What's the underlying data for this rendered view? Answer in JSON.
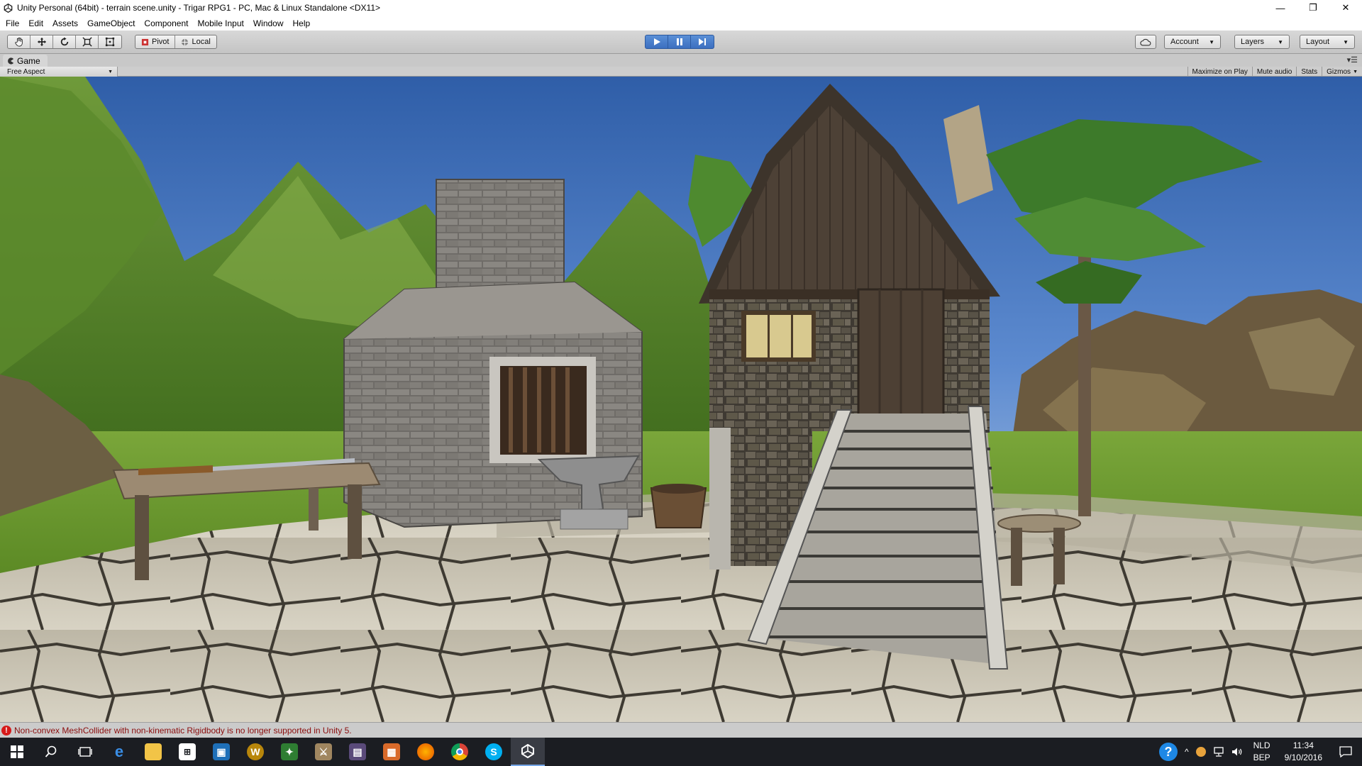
{
  "window": {
    "title": "Unity Personal (64bit) - terrain scene.unity - Trigar RPG1 - PC, Mac & Linux Standalone <DX11>",
    "controls": [
      "—",
      "❐",
      "✕"
    ]
  },
  "menu": [
    "File",
    "Edit",
    "Assets",
    "GameObject",
    "Component",
    "Mobile Input",
    "Window",
    "Help"
  ],
  "toolbar": {
    "pivot_label": "Pivot",
    "local_label": "Local",
    "account_label": "Account",
    "layers_label": "Layers",
    "layout_label": "Layout"
  },
  "game_panel": {
    "tab_label": "Game",
    "aspect_label": "Free Aspect",
    "toggles": [
      "Maximize on Play",
      "Mute audio",
      "Stats",
      "Gizmos"
    ]
  },
  "status": {
    "message": "Non-convex MeshCollider with non-kinematic Rigidbody is no longer supported in Unity 5."
  },
  "taskbar": {
    "language_top": "NLD",
    "language_bottom": "BEP",
    "time": "11:34",
    "date": "9/10/2016",
    "help_glyph": "?"
  },
  "colors": {
    "play_blue": "#3c6fc0",
    "error_red": "#d61a1a",
    "taskbar_bg": "#1b1d22"
  }
}
